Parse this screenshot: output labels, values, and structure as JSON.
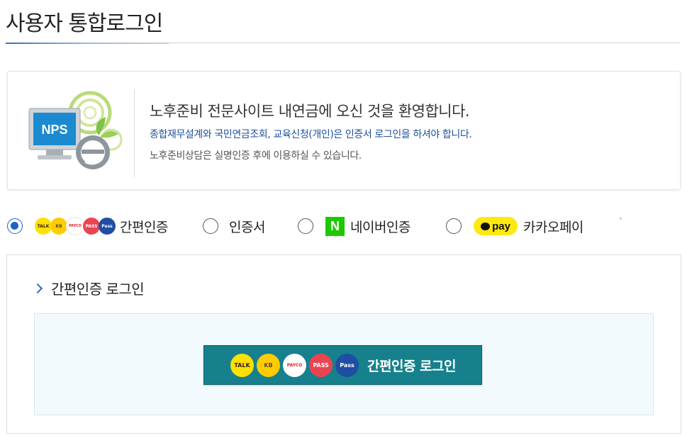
{
  "page": {
    "title": "사용자 통합로그인"
  },
  "welcome": {
    "logo_text": "NPS",
    "title": "노후준비 전문사이트 내연금에 오신 것을 환영합니다.",
    "notice_blue": "종합재무설계와 국민연금조회, 교육신청(개인)은 인증서 로그인을 하셔야 합니다.",
    "notice_gray": "노후준비상담은 실명인증 후에 이용하실 수 있습니다."
  },
  "auth_options": {
    "selected": "simple",
    "items": [
      {
        "key": "simple",
        "label": "간편인증",
        "icons": [
          "kakao-talk-icon",
          "kb-icon",
          "payco-icon",
          "pass-icon",
          "samsung-pass-icon"
        ]
      },
      {
        "key": "cert",
        "label": "인증서"
      },
      {
        "key": "naver",
        "label": "네이버인증",
        "icon_text": "N"
      },
      {
        "key": "kakaopay",
        "label": "카카오페이",
        "icon_text": "pay"
      }
    ]
  },
  "login_panel": {
    "section_title": "간편인증 로그인",
    "button_label": "간편인증 로그인",
    "button_icons": [
      {
        "name": "kakao-talk-icon",
        "text": "TALK",
        "bg": "#ffe100",
        "fg": "#3a1d1d"
      },
      {
        "name": "kb-icon",
        "text": "KB",
        "bg": "#ffcc00",
        "fg": "#5a4a3a"
      },
      {
        "name": "payco-icon",
        "text": "PAYCO",
        "bg": "#ffffff",
        "fg": "#e0242c"
      },
      {
        "name": "pass-icon",
        "text": "PASS",
        "bg": "#ea4453",
        "fg": "#ffffff"
      },
      {
        "name": "samsung-pass-icon",
        "text": "Pass",
        "bg": "#1f4ea3",
        "fg": "#ffffff"
      }
    ]
  },
  "colors": {
    "accent": "#1d62c8",
    "button_bg": "#17808d",
    "naver_green": "#1ec800",
    "kakao_yellow": "#ffe812"
  }
}
